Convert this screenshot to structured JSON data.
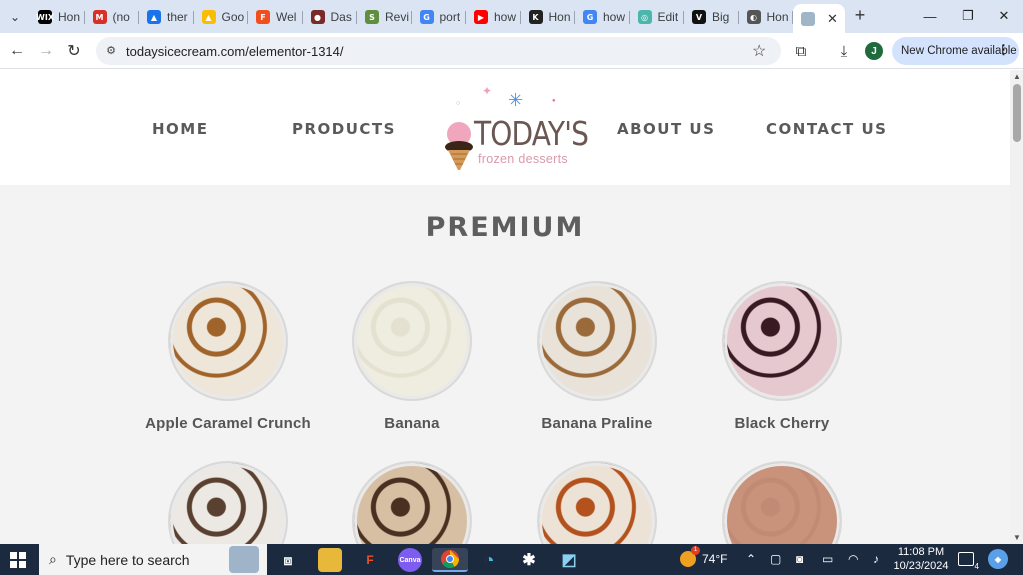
{
  "browser": {
    "tabs": [
      {
        "label": "Hon",
        "icon": "wix-icon",
        "color": "#000000",
        "glyph": "WIX"
      },
      {
        "label": "(no",
        "icon": "gmail-icon",
        "color": "#d93025",
        "glyph": "M"
      },
      {
        "label": "ther",
        "icon": "google-drive-icon",
        "color": "#1a73e8",
        "glyph": "▲"
      },
      {
        "label": "Goo",
        "icon": "google-drive-icon",
        "color": "#fbbc04",
        "glyph": "▲"
      },
      {
        "label": "Wel",
        "icon": "figma-icon",
        "color": "#f24e1e",
        "glyph": "F"
      },
      {
        "label": "Das",
        "icon": "avatar-icon",
        "color": "#7a2a2a",
        "glyph": "●"
      },
      {
        "label": "Revi",
        "icon": "shopify-icon",
        "color": "#5e8e3e",
        "glyph": "S"
      },
      {
        "label": "port",
        "icon": "google-icon",
        "color": "#4285f4",
        "glyph": "G"
      },
      {
        "label": "how",
        "icon": "youtube-icon",
        "color": "#ff0000",
        "glyph": "▶"
      },
      {
        "label": "Hon",
        "icon": "site-icon",
        "color": "#222222",
        "glyph": "K"
      },
      {
        "label": "how",
        "icon": "google-icon",
        "color": "#4285f4",
        "glyph": "G"
      },
      {
        "label": "Edit",
        "icon": "edit-icon",
        "color": "#4db6ac",
        "glyph": "◎"
      },
      {
        "label": "Big",
        "icon": "bookmark-icon",
        "color": "#111111",
        "glyph": "V"
      },
      {
        "label": "Hon",
        "icon": "globe-icon",
        "color": "#555555",
        "glyph": "◐"
      }
    ],
    "active_tab": {
      "icon": "image-icon",
      "color": "#9fb6c9"
    },
    "url": "todaysicecream.com/elementor-1314/",
    "profile_initial": "J",
    "update_chip": "New Chrome available"
  },
  "site": {
    "nav": {
      "home": "HOME",
      "products": "PRODUCTS",
      "about": "ABOUT US",
      "contact": "CONTACT US"
    },
    "logo": {
      "title": "TODAY'S",
      "subtitle": "frozen desserts"
    },
    "section_title": "PREMIUM",
    "products": [
      {
        "name": "Apple Caramel Crunch",
        "base": "#efe6da",
        "swirl": "#a0642a"
      },
      {
        "name": "Banana",
        "base": "#efece0",
        "swirl": "#e5e1d0"
      },
      {
        "name": "Banana Praline",
        "base": "#e8e2d8",
        "swirl": "#9a6a3a"
      },
      {
        "name": "Black Cherry",
        "base": "#e6c9cf",
        "swirl": "#3a1a22"
      },
      {
        "name": "",
        "base": "#ece8e4",
        "swirl": "#5a4030"
      },
      {
        "name": "",
        "base": "#d6bfa3",
        "swirl": "#4a3020"
      },
      {
        "name": "",
        "base": "#ece2d6",
        "swirl": "#b4521e"
      },
      {
        "name": "",
        "base": "#c9927a",
        "swirl": "#c08a74"
      }
    ]
  },
  "taskbar": {
    "search_placeholder": "Type here to search",
    "weather": "74°F",
    "weather_badge": "1",
    "time": "11:08 PM",
    "date": "10/23/2024",
    "notification_count": "4"
  }
}
